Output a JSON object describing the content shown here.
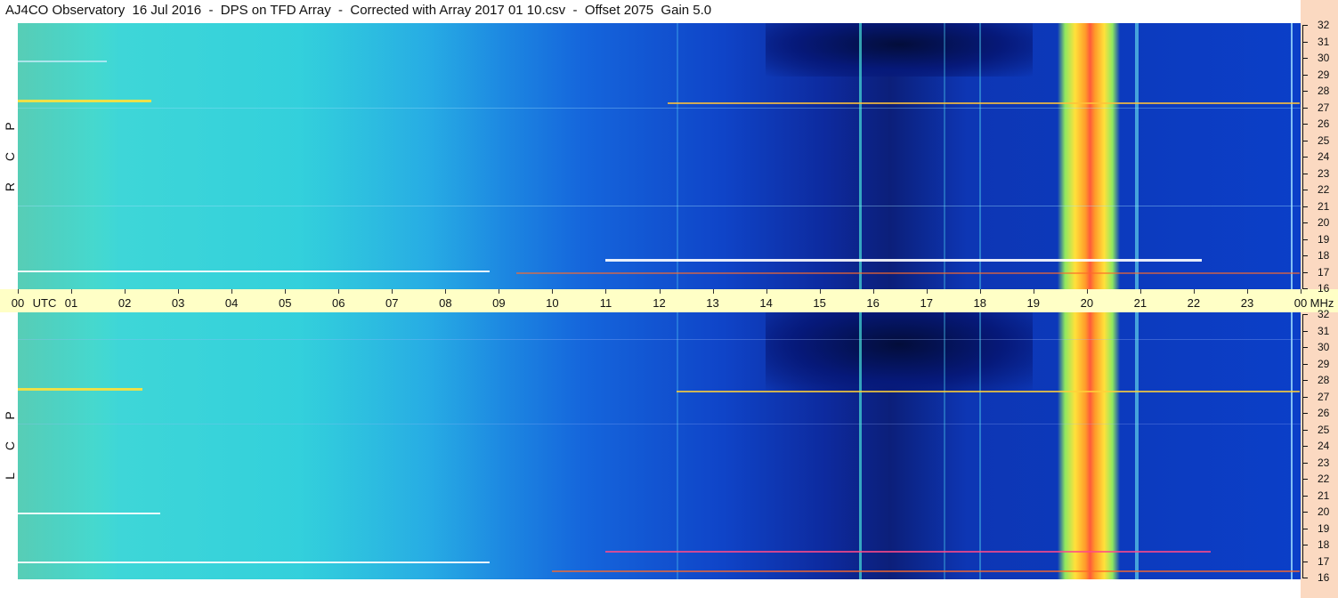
{
  "title": "AJ4CO Observatory  16 Jul 2016  -  DPS on TFD Array  -  Corrected with Array 2017 01 10.csv  -  Offset 2075  Gain 5.0",
  "colors": {
    "utc_bar": "#ffffc6",
    "side_strip": "#fbd9c1",
    "background_low": "#0a2fbf",
    "background_high": "#34e0d0",
    "hot": "#ff4a2a"
  },
  "chart_data": {
    "type": "heatmap",
    "x": {
      "unit": "UTC",
      "ticks": [
        "00",
        "01",
        "02",
        "03",
        "04",
        "05",
        "06",
        "07",
        "08",
        "09",
        "10",
        "11",
        "12",
        "13",
        "14",
        "15",
        "16",
        "17",
        "18",
        "19",
        "20",
        "21",
        "22",
        "23",
        "00"
      ],
      "first_label_suffix": "UTC",
      "range": [
        0,
        24
      ]
    },
    "y": {
      "unit": "MHz",
      "ticks": [
        "32",
        "31",
        "30",
        "29",
        "28",
        "27",
        "26",
        "25",
        "24",
        "23",
        "22",
        "21",
        "20",
        "19",
        "18",
        "17",
        "16"
      ],
      "range": [
        16,
        32
      ]
    },
    "panels": [
      {
        "polarization": "RCP",
        "letters": [
          "R",
          "C",
          "P"
        ]
      },
      {
        "polarization": "LCP",
        "letters": [
          "L",
          "C",
          "P"
        ]
      }
    ]
  }
}
